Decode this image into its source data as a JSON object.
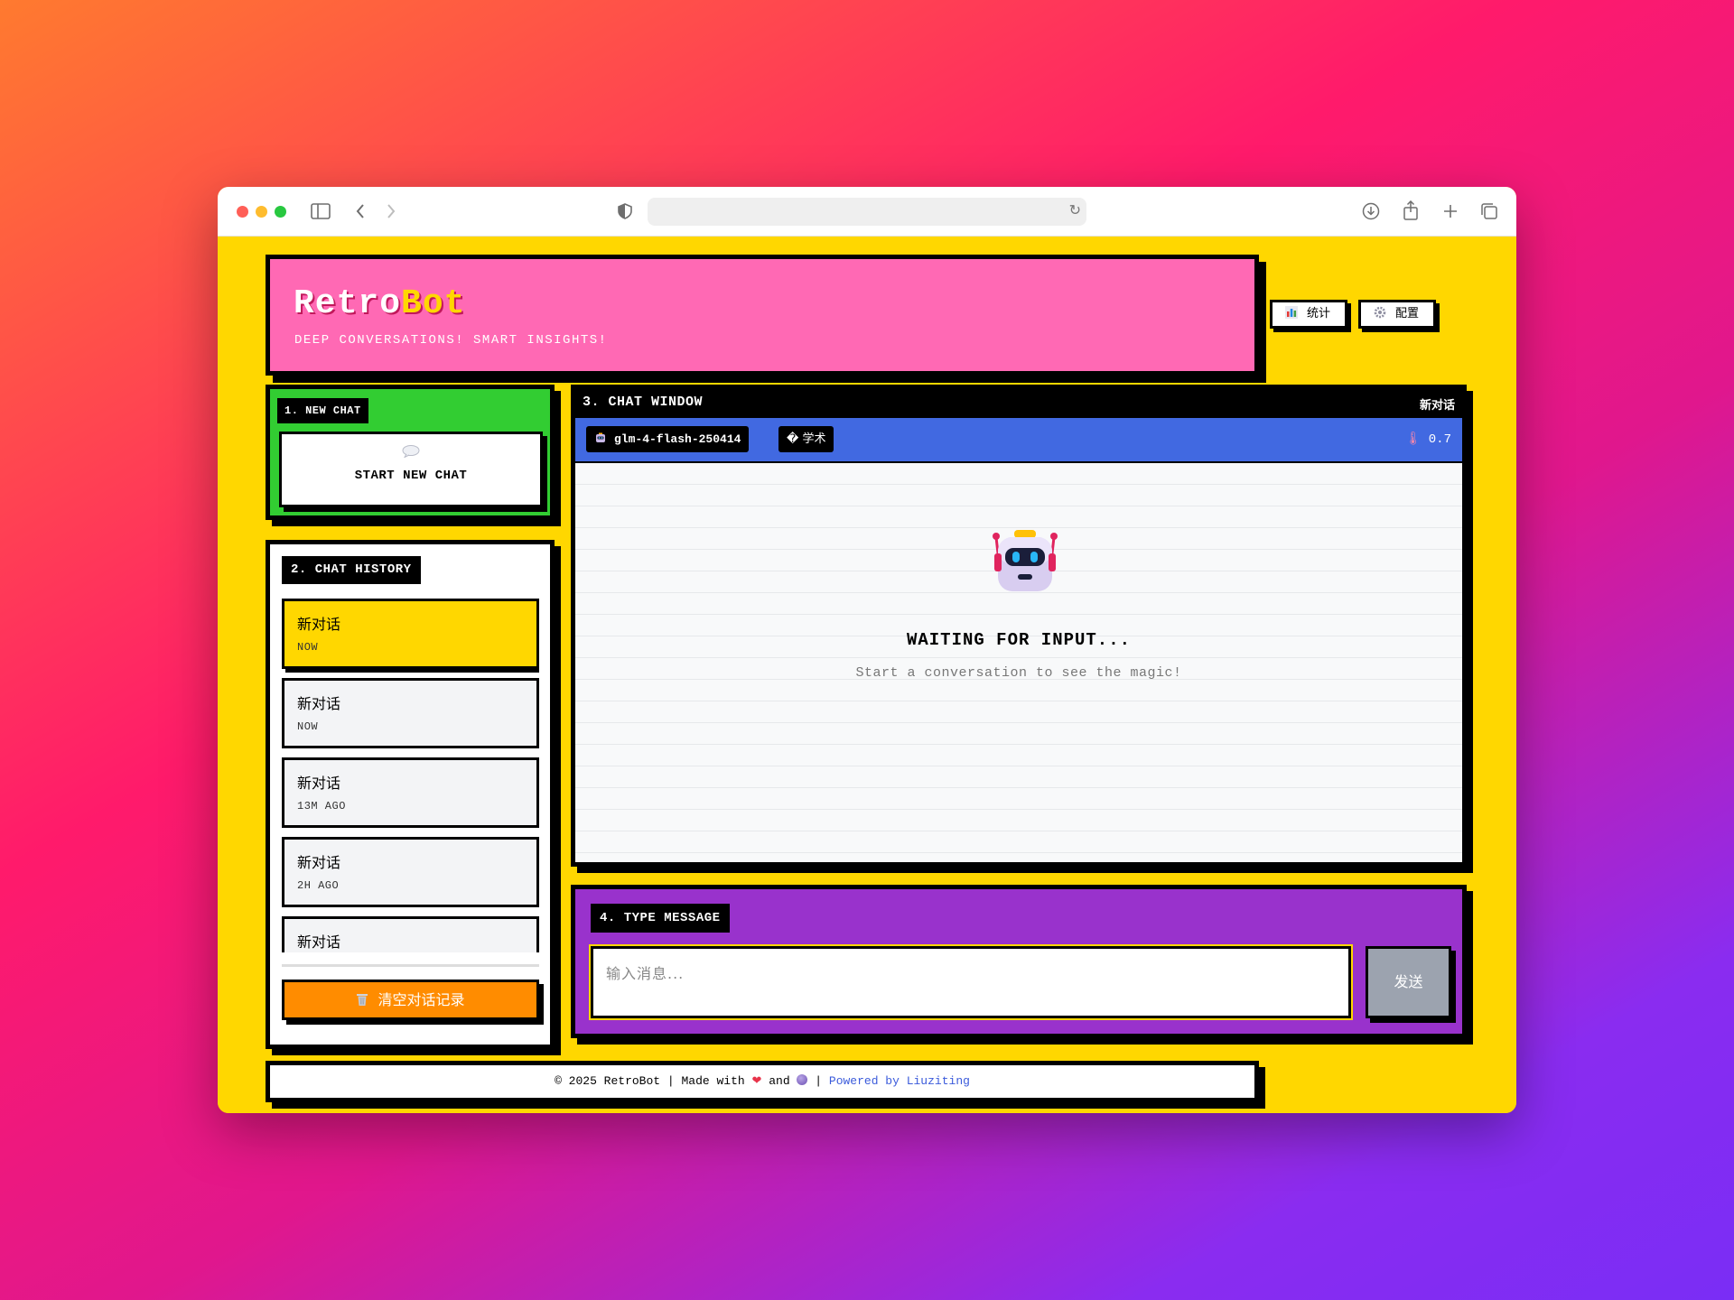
{
  "browser": {
    "url": ""
  },
  "header": {
    "brand_part1": "Retro",
    "brand_part2": "Bot",
    "tagline": "DEEP CONVERSATIONS! SMART INSIGHTS!",
    "stats_label": "统计",
    "config_label": "配置"
  },
  "new_chat": {
    "section_label": "1. NEW CHAT",
    "button_label": "START NEW CHAT"
  },
  "history": {
    "section_label": "2. CHAT HISTORY",
    "items": [
      {
        "title": "新对话",
        "time": "NOW",
        "active": true
      },
      {
        "title": "新对话",
        "time": "NOW",
        "active": false
      },
      {
        "title": "新对话",
        "time": "13M AGO",
        "active": false
      },
      {
        "title": "新对话",
        "time": "2H AGO",
        "active": false
      },
      {
        "title": "新对话",
        "time": "",
        "active": false
      }
    ],
    "clear_label": "清空对话记录"
  },
  "chat_window": {
    "section_label": "3. CHAT WINDOW",
    "conversation_title": "新对话",
    "model": "glm-4-flash-250414",
    "mode": "� 学术",
    "temperature": "0.7",
    "empty_title": "WAITING FOR INPUT...",
    "empty_hint": "Start a conversation to see the magic!"
  },
  "input": {
    "section_label": "4. TYPE MESSAGE",
    "placeholder": "输入消息...",
    "send_label": "发送"
  },
  "footer": {
    "copyright": "© 2025 RetroBot | Made with",
    "and": "and",
    "separator": "|",
    "powered": "Powered by Liuziting"
  },
  "colors": {
    "page_bg": "#ffd700",
    "header_bg": "#ff69b4",
    "new_chat_bg": "#32cd32",
    "chat_bar_bg": "#4169e1",
    "input_panel_bg": "#9932cc",
    "clear_button_bg": "#ff8c00",
    "send_button_bg": "#9ca3af"
  }
}
